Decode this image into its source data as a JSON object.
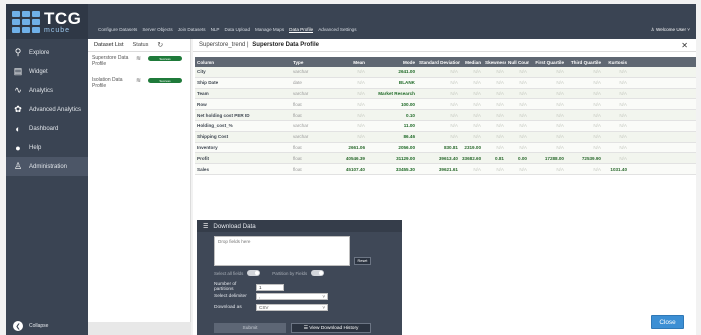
{
  "app": {
    "logo_main": "TCG",
    "logo_sub": "mcube"
  },
  "sidebar": {
    "items": [
      {
        "label": "Explore",
        "icon": "search-icon"
      },
      {
        "label": "Widget",
        "icon": "chart-icon"
      },
      {
        "label": "Analytics",
        "icon": "line-chart-icon"
      },
      {
        "label": "Advanced Analytics",
        "icon": "network-icon"
      },
      {
        "label": "Dashboard",
        "icon": "dashboard-icon"
      },
      {
        "label": "Help",
        "icon": "info-icon"
      },
      {
        "label": "Administration",
        "icon": "user-icon"
      }
    ],
    "collapse_label": "Collapse"
  },
  "topbar": {
    "menu": [
      "Configure Datasets",
      "Server Objects",
      "Join Datasets",
      "NLP",
      "Data Upload",
      "Manage Maps",
      "Data Profile",
      "Advanced Settings"
    ],
    "active": "Data Profile",
    "user": "Welcome User"
  },
  "left_panel": {
    "tabs": [
      "Dataset List",
      "Status"
    ],
    "datasets": [
      {
        "name": "Superstore Data Profile",
        "status": "Success"
      },
      {
        "name": "Isolation Data Profile",
        "status": "Success"
      }
    ]
  },
  "main": {
    "breadcrumb": "Superstore_trend",
    "title": "Superstore Data Profile",
    "columns": [
      "Column",
      "Type",
      "Mean",
      "Mode",
      "Standard Deviation",
      "Median",
      "Skewness",
      "Null Count",
      "First Quartile",
      "Third Quartile",
      "Kurtosis"
    ],
    "rows": [
      {
        "name": "City",
        "type": "varchar",
        "mean": "N/A",
        "mode": "2641.00",
        "std": "N/A",
        "median": "N/A",
        "skew": "N/A",
        "null": "N/A",
        "q1": "N/A",
        "q3": "N/A",
        "kurt": "N/A"
      },
      {
        "name": "Ship Date",
        "type": "date",
        "mean": "N/A",
        "mode": "BLANK",
        "std": "N/A",
        "median": "N/A",
        "skew": "N/A",
        "null": "N/A",
        "q1": "N/A",
        "q3": "N/A",
        "kurt": "N/A"
      },
      {
        "name": "Team",
        "type": "varchar",
        "mean": "N/A",
        "mode": "Market Research",
        "std": "N/A",
        "median": "N/A",
        "skew": "N/A",
        "null": "N/A",
        "q1": "N/A",
        "q3": "N/A",
        "kurt": "N/A"
      },
      {
        "name": "Row",
        "type": "float",
        "mean": "N/A",
        "mode": "100.00",
        "std": "N/A",
        "median": "N/A",
        "skew": "N/A",
        "null": "N/A",
        "q1": "N/A",
        "q3": "N/A",
        "kurt": "N/A"
      },
      {
        "name": "Net holding cost PER ID",
        "type": "float",
        "mean": "N/A",
        "mode": "0.10",
        "std": "N/A",
        "median": "N/A",
        "skew": "N/A",
        "null": "N/A",
        "q1": "N/A",
        "q3": "N/A",
        "kurt": "N/A"
      },
      {
        "name": "Holding_cost_%",
        "type": "varchar",
        "mean": "N/A",
        "mode": "11.00",
        "std": "N/A",
        "median": "N/A",
        "skew": "N/A",
        "null": "N/A",
        "q1": "N/A",
        "q3": "N/A",
        "kurt": "N/A"
      },
      {
        "name": "Shipping Cost",
        "type": "varchar",
        "mean": "N/A",
        "mode": "86.46",
        "std": "N/A",
        "median": "N/A",
        "skew": "N/A",
        "null": "N/A",
        "q1": "N/A",
        "q3": "N/A",
        "kurt": "N/A"
      },
      {
        "name": "Inventory",
        "type": "float",
        "mean": "2661.06",
        "mode": "2056.00",
        "std": "830.81",
        "median": "2319.00",
        "skew": "N/A",
        "null": "N/A",
        "q1": "N/A",
        "q3": "N/A",
        "kurt": "N/A"
      },
      {
        "name": "Profit",
        "type": "float",
        "mean": "40546.39",
        "mode": "31129.00",
        "std": "39613.40",
        "median": "33682.60",
        "skew": "0.81",
        "null": "0.00",
        "q1": "17288.00",
        "q3": "72539.90",
        "kurt": "N/A"
      },
      {
        "name": "Sales",
        "type": "float",
        "mean": "45107.40",
        "mode": "33455.30",
        "std": "39621.61",
        "median": "N/A",
        "skew": "N/A",
        "null": "N/A",
        "q1": "N/A",
        "q3": "N/A",
        "kurt": "1031.40"
      }
    ]
  },
  "download": {
    "header": "Download Data",
    "placeholder": "Drop fields here",
    "reset": "Reset",
    "toggle1": "Select all fields",
    "toggle2": "Partition by Fields",
    "partitions_label": "Number of partitions",
    "partitions_value": "1",
    "delimiter_label": "Select delimiter",
    "delimiter_value": ",",
    "download_as_label": "Download as",
    "download_as_value": "CSV",
    "submit": "Submit",
    "history": "View Download History"
  },
  "footer": {
    "close": "Close"
  }
}
